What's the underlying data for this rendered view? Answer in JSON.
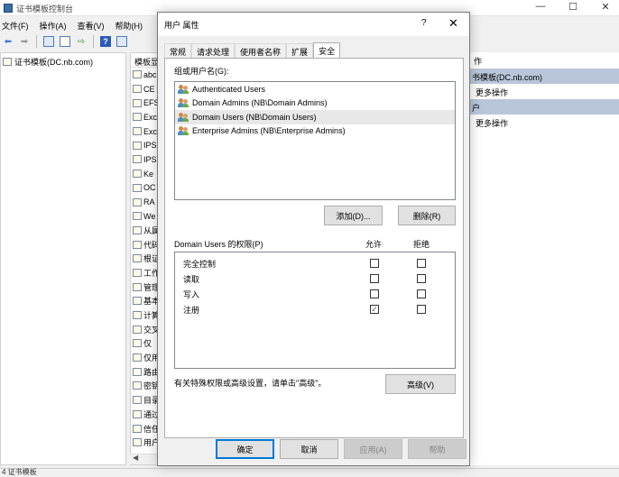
{
  "window": {
    "title": "证书模板控制台"
  },
  "menu": [
    "文件(F)",
    "操作(A)",
    "查看(V)",
    "帮助(H)"
  ],
  "tree": {
    "root": "证书模板(DC.nb.com)"
  },
  "list": {
    "header": "模板显",
    "items": [
      "abc",
      "CE",
      "EFS",
      "Exc",
      "Exc",
      "IPS",
      "IPS",
      "Ke",
      "OC",
      "RA",
      "We",
      "从属",
      "代码",
      "根证",
      "工作",
      "管理",
      "基本",
      "计算",
      "交叉",
      "仅",
      "仅用",
      "路由",
      "密钥",
      "目录",
      "通过",
      "信任",
      "用户"
    ]
  },
  "actions": {
    "header": "作",
    "group1": "书模板(DC.nb.com)",
    "group1_item": "更多操作",
    "group2": "户",
    "group2_item": "更多操作"
  },
  "statusbar": "4 证书模板",
  "dialog": {
    "title": "用户 属性",
    "help": "?",
    "close": "✕",
    "tabs": [
      "常规",
      "请求处理",
      "使用者名称",
      "扩展",
      "安全"
    ],
    "active_tab": 4,
    "group_label": "组或用户名(G):",
    "users": [
      "Authenticated Users",
      "Domain Admins (NB\\Domain Admins)",
      "Domain Users (NB\\Domain Users)",
      "Enterprise Admins (NB\\Enterprise Admins)"
    ],
    "selected_user": 2,
    "add_button": "添加(D)...",
    "remove_button": "删除(R)",
    "perm_label": "Domain Users 的权限(P)",
    "allow_header": "允许",
    "deny_header": "拒绝",
    "permissions": [
      {
        "name": "完全控制",
        "allow": false,
        "deny": false
      },
      {
        "name": "读取",
        "allow": false,
        "deny": false
      },
      {
        "name": "写入",
        "allow": false,
        "deny": false
      },
      {
        "name": "注册",
        "allow": true,
        "deny": false
      }
    ],
    "advanced_note": "有关特殊权限或高级设置，请单击\"高级\"。",
    "advanced_button": "高级(V)",
    "ok_button": "确定",
    "cancel_button": "取消",
    "apply_button": "应用(A)",
    "help_button": "帮助"
  }
}
